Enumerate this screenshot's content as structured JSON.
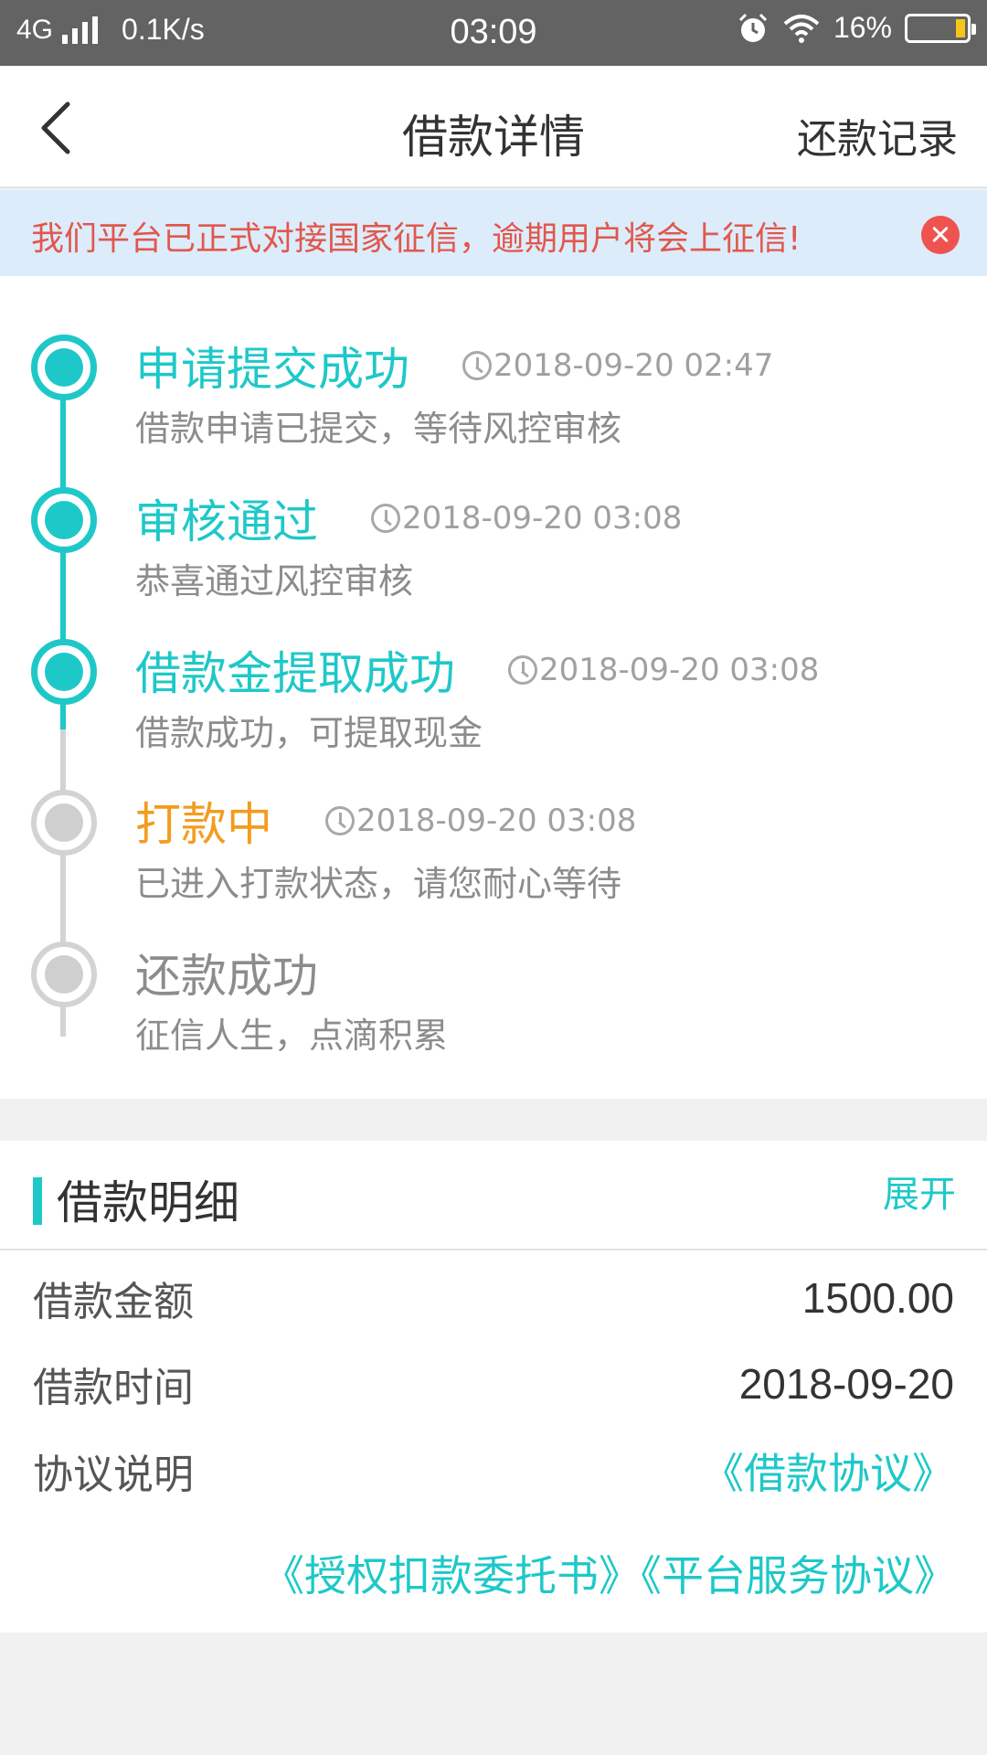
{
  "status_bar": {
    "network": "4G",
    "speed": "0.1K/s",
    "time": "03:09",
    "battery": "16%",
    "icons": [
      "signal-icon",
      "alarm-icon",
      "wifi-icon",
      "battery-icon"
    ]
  },
  "header": {
    "title": "借款详情",
    "right_action": "还款记录"
  },
  "notice": {
    "text": "我们平台已正式对接国家征信，逾期用户将会上征信!"
  },
  "timeline": [
    {
      "title": "申请提交成功",
      "time": "2018-09-20 02:47",
      "desc": "借款申请已提交，等待风控审核",
      "state": "done"
    },
    {
      "title": "审核通过",
      "time": "2018-09-20 03:08",
      "desc": "恭喜通过风控审核",
      "state": "done"
    },
    {
      "title": "借款金提取成功",
      "time": "2018-09-20 03:08",
      "desc": "借款成功，可提取现金",
      "state": "done"
    },
    {
      "title": "打款中",
      "time": "2018-09-20 03:08",
      "desc": "已进入打款状态，请您耐心等待",
      "state": "current"
    },
    {
      "title": "还款成功",
      "time": "",
      "desc": "征信人生，点滴积累",
      "state": "pending"
    }
  ],
  "details": {
    "title": "借款明细",
    "expand": "展开",
    "amount_label": "借款金额",
    "amount_value": "1500.00",
    "date_label": "借款时间",
    "date_value": "2018-09-20",
    "agreement_label": "协议说明",
    "link_loan": "《借款协议》",
    "link_authorize": "《授权扣款委托书》",
    "link_service": "《平台服务协议》"
  },
  "colors": {
    "accent": "#1ec8c8",
    "warning": "#f39c1f",
    "notice_text": "#e2574c",
    "notice_bg": "#dcecfb"
  }
}
